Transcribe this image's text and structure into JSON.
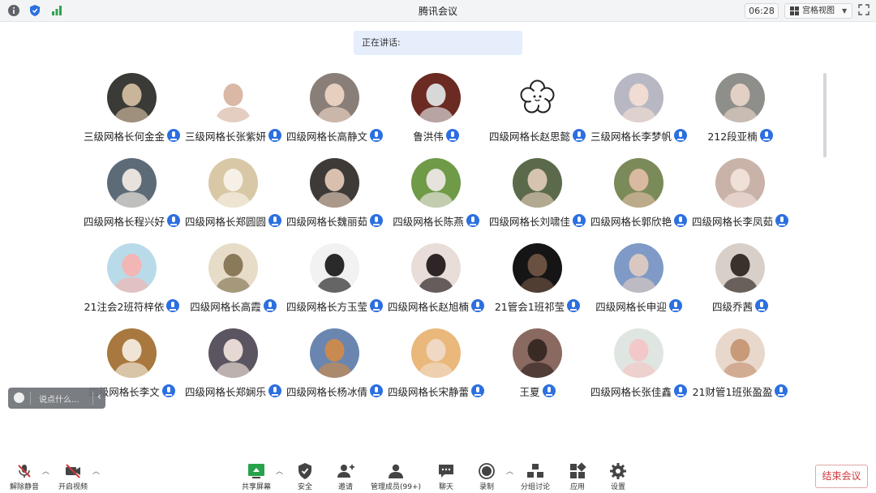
{
  "window": {
    "title": "腾讯会议",
    "time": "06:28",
    "view_label": "宫格视图"
  },
  "speaking": {
    "label": "正在讲话:"
  },
  "participants": [
    {
      "name": "三级网格长何金金",
      "avatar_color": "#3a3a36",
      "face_color": "#c9b59a"
    },
    {
      "name": "三级网格长张紫妍",
      "avatar_color": "#ffffff",
      "face_color": "#d9b8a6"
    },
    {
      "name": "四级网格长高静文",
      "avatar_color": "#8a7f78",
      "face_color": "#e7cfbf"
    },
    {
      "name": "鲁洪伟",
      "avatar_color": "#6b2a22",
      "face_color": "#d8d8d8"
    },
    {
      "name": "四级网格长赵思懿",
      "avatar_color": "#ffffff",
      "face_color": "#ffffff"
    },
    {
      "name": "三级网格长李梦帆",
      "avatar_color": "#b8b8c4",
      "face_color": "#f0dcd2"
    },
    {
      "name": "212段亚楠",
      "avatar_color": "#8e8e8a",
      "face_color": "#e2d0c4"
    },
    {
      "name": "四级网格长程兴好",
      "avatar_color": "#5d6b78",
      "face_color": "#e9e2dc"
    },
    {
      "name": "四级网格长郑圆圆",
      "avatar_color": "#d8c8a6",
      "face_color": "#f6f0e6"
    },
    {
      "name": "四级网格长魏丽茹",
      "avatar_color": "#3e3a38",
      "face_color": "#d9c0ae"
    },
    {
      "name": "四级网格长陈燕",
      "avatar_color": "#6f9a48",
      "face_color": "#e6e2dc"
    },
    {
      "name": "四级网格长刘啸佳",
      "avatar_color": "#5b6a4a",
      "face_color": "#d7c4ae"
    },
    {
      "name": "四级网格长郭欣艳",
      "avatar_color": "#7a8a58",
      "face_color": "#d9b9a0"
    },
    {
      "name": "四级网格长李凤茹",
      "avatar_color": "#c9b2a8",
      "face_color": "#efe0d8"
    },
    {
      "name": "21注会2班符梓依",
      "avatar_color": "#b9dbe9",
      "face_color": "#f2b6b4"
    },
    {
      "name": "四级网格长高霞",
      "avatar_color": "#e6dcc8",
      "face_color": "#8a7a5a"
    },
    {
      "name": "四级网格长方玉莹",
      "avatar_color": "#f2f2f2",
      "face_color": "#2a2a2a"
    },
    {
      "name": "四级网格长赵旭楠",
      "avatar_color": "#e8ddd8",
      "face_color": "#2e2626"
    },
    {
      "name": "21管会1班祁莹",
      "avatar_color": "#151515",
      "face_color": "#6a5040"
    },
    {
      "name": "四级网格长申迎",
      "avatar_color": "#7f9ac6",
      "face_color": "#d9c8c2"
    },
    {
      "name": "四级乔茜",
      "avatar_color": "#d8cfc8",
      "face_color": "#3a302c"
    },
    {
      "name": "四级网格长李文",
      "avatar_color": "#a8783e",
      "face_color": "#f0e4d4"
    },
    {
      "name": "四级网格长郑娴乐",
      "avatar_color": "#5a5560",
      "face_color": "#e6d8d2"
    },
    {
      "name": "四级网格长杨冰倩",
      "avatar_color": "#6a86b0",
      "face_color": "#c88a50"
    },
    {
      "name": "四级网格长宋静蕾",
      "avatar_color": "#e9b87a",
      "face_color": "#f0d8c4"
    },
    {
      "name": "王夏",
      "avatar_color": "#8a6a60",
      "face_color": "#3a2a26"
    },
    {
      "name": "四级网格长张佳鑫",
      "avatar_color": "#dfe6e2",
      "face_color": "#f2c8c8"
    },
    {
      "name": "21财管1班张盈盈",
      "avatar_color": "#e8d8cc",
      "face_color": "#c89a7a"
    }
  ],
  "chat": {
    "placeholder": "说点什么..."
  },
  "toolbar": {
    "unmute": "解除静音",
    "start_video": "开启视频",
    "share_screen": "共享屏幕",
    "security": "安全",
    "invite": "邀请",
    "manage_members": "管理成员(99+)",
    "chat": "聊天",
    "record": "录制",
    "breakout": "分组讨论",
    "apps": "应用",
    "settings": "设置",
    "end_meeting": "结束会议"
  },
  "colors": {
    "accent": "#2c6fe0",
    "end": "#d0393a",
    "speaking_bg": "#e6eefc"
  }
}
